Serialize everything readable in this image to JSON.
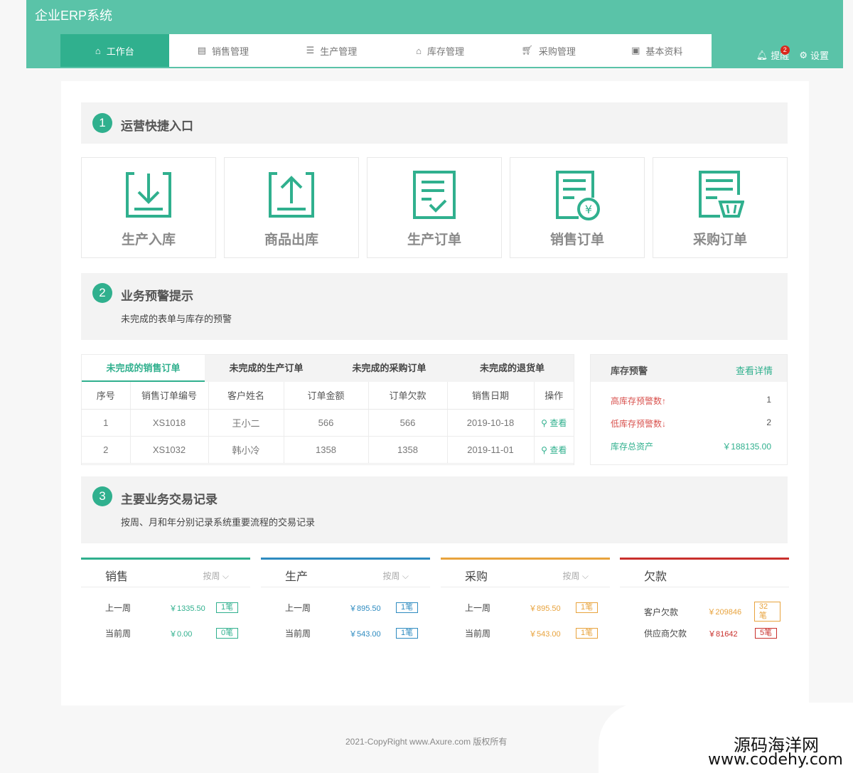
{
  "app": {
    "title": "企业ERP系统"
  },
  "nav": {
    "items": [
      {
        "label": "工作台",
        "icon": "home-icon"
      },
      {
        "label": "销售管理",
        "icon": "clipboard-icon"
      },
      {
        "label": "生产管理",
        "icon": "list-icon"
      },
      {
        "label": "库存管理",
        "icon": "warehouse-icon"
      },
      {
        "label": "采购管理",
        "icon": "cart-icon"
      },
      {
        "label": "基本资料",
        "icon": "image-icon"
      }
    ],
    "active": 0
  },
  "header_right": {
    "remind_label": "提醒",
    "remind_badge": "2",
    "settings_label": "设置"
  },
  "section1": {
    "num": "1",
    "title": "运营快捷入口"
  },
  "quick_entries": [
    {
      "label": "生产入库",
      "icon": "download-tray-icon"
    },
    {
      "label": "商品出库",
      "icon": "upload-tray-icon"
    },
    {
      "label": "生产订单",
      "icon": "checklist-icon"
    },
    {
      "label": "销售订单",
      "icon": "invoice-yen-icon"
    },
    {
      "label": "采购订单",
      "icon": "order-basket-icon"
    }
  ],
  "section2": {
    "num": "2",
    "title": "业务预警提示",
    "desc": "未完成的表单与库存的预警"
  },
  "orders": {
    "tabs": [
      "未完成的销售订单",
      "未完成的生产订单",
      "未完成的采购订单",
      "未完成的退货单"
    ],
    "columns": [
      "序号",
      "销售订单编号",
      "客户姓名",
      "订单金额",
      "订单欠款",
      "销售日期",
      "操作"
    ],
    "rows": [
      {
        "no": "1",
        "code": "XS1018",
        "customer": "王小二",
        "amount": "566",
        "debt": "566",
        "date": "2019-10-18",
        "action": "查看"
      },
      {
        "no": "2",
        "code": "XS1032",
        "customer": "韩小冷",
        "amount": "1358",
        "debt": "1358",
        "date": "2019-11-01",
        "action": "查看"
      }
    ]
  },
  "stock": {
    "title": "库存预警",
    "link": "查看详情",
    "rows": [
      {
        "label": "高库存预警数↑",
        "value": "1",
        "color": "#d9534f"
      },
      {
        "label": "低库存预警数↓",
        "value": "2",
        "color": "#d9534f"
      },
      {
        "label": "库存总资产",
        "value": "￥188135.00",
        "color": "#30b08e"
      }
    ]
  },
  "section3": {
    "num": "3",
    "title": "主要业务交易记录",
    "desc": "按周、月和年分别记录系统重要流程的交易记录"
  },
  "records": [
    {
      "title": "销售",
      "dropdown": "按周",
      "color": "#30b08e",
      "rows": [
        {
          "label": "上一周",
          "amount": "￥1335.50",
          "count": "1笔"
        },
        {
          "label": "当前周",
          "amount": "￥0.00",
          "count": "0笔"
        }
      ]
    },
    {
      "title": "生产",
      "dropdown": "按周",
      "color": "#2e8bc0",
      "rows": [
        {
          "label": "上一周",
          "amount": "￥895.50",
          "count": "1笔"
        },
        {
          "label": "当前周",
          "amount": "￥543.00",
          "count": "1笔"
        }
      ]
    },
    {
      "title": "采购",
      "dropdown": "按周",
      "color": "#e8a33d",
      "rows": [
        {
          "label": "上一周",
          "amount": "￥895.50",
          "count": "1笔"
        },
        {
          "label": "当前周",
          "amount": "￥543.00",
          "count": "1笔"
        }
      ]
    },
    {
      "title": "欠款",
      "dropdown": "",
      "color": "#c9302c",
      "rows": [
        {
          "label": "客户欠款",
          "amount": "￥209846",
          "count": "32笔",
          "amountColor": "#e8a33d"
        },
        {
          "label": "供应商欠款",
          "amount": "￥81642",
          "count": "5笔",
          "amountColor": "#c9302c"
        }
      ]
    }
  ],
  "footer": "2021-CopyRight www.Axure.com 版权所有",
  "watermark": {
    "line1": "源码海洋网",
    "line2": "www.codehy.com"
  }
}
